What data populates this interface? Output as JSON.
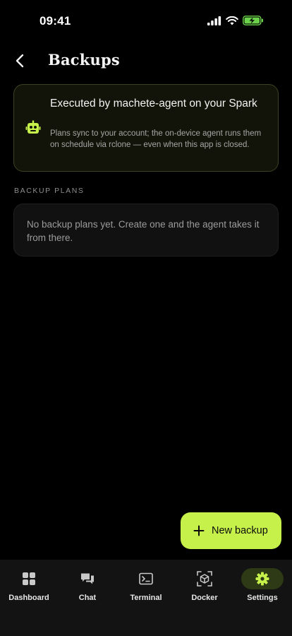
{
  "status_bar": {
    "time": "09:41"
  },
  "header": {
    "title": "Backups"
  },
  "info_card": {
    "title": "Executed by machete-agent on your Spark",
    "description": "Plans sync to your account; the on-device agent runs them on schedule via rclone — even when this app is closed.",
    "icon": "robot-icon"
  },
  "backup_plans": {
    "section_label": "BACKUP PLANS",
    "empty_message": "No backup plans yet. Create one and the agent takes it from there."
  },
  "fab": {
    "label": "New backup",
    "icon": "plus-icon"
  },
  "bottom_nav": {
    "items": [
      {
        "label": "Dashboard",
        "icon": "dashboard-grid-icon",
        "active": false
      },
      {
        "label": "Chat",
        "icon": "chat-icon",
        "active": false
      },
      {
        "label": "Terminal",
        "icon": "terminal-icon",
        "active": false
      },
      {
        "label": "Docker",
        "icon": "docker-cube-icon",
        "active": false
      },
      {
        "label": "Settings",
        "icon": "gear-icon",
        "active": true
      }
    ]
  },
  "colors": {
    "accent": "#c6f14a",
    "background": "#000000",
    "card_border_accent": "#3a4420",
    "nav_background": "#131313",
    "nav_active_pill": "#2d3a15"
  }
}
